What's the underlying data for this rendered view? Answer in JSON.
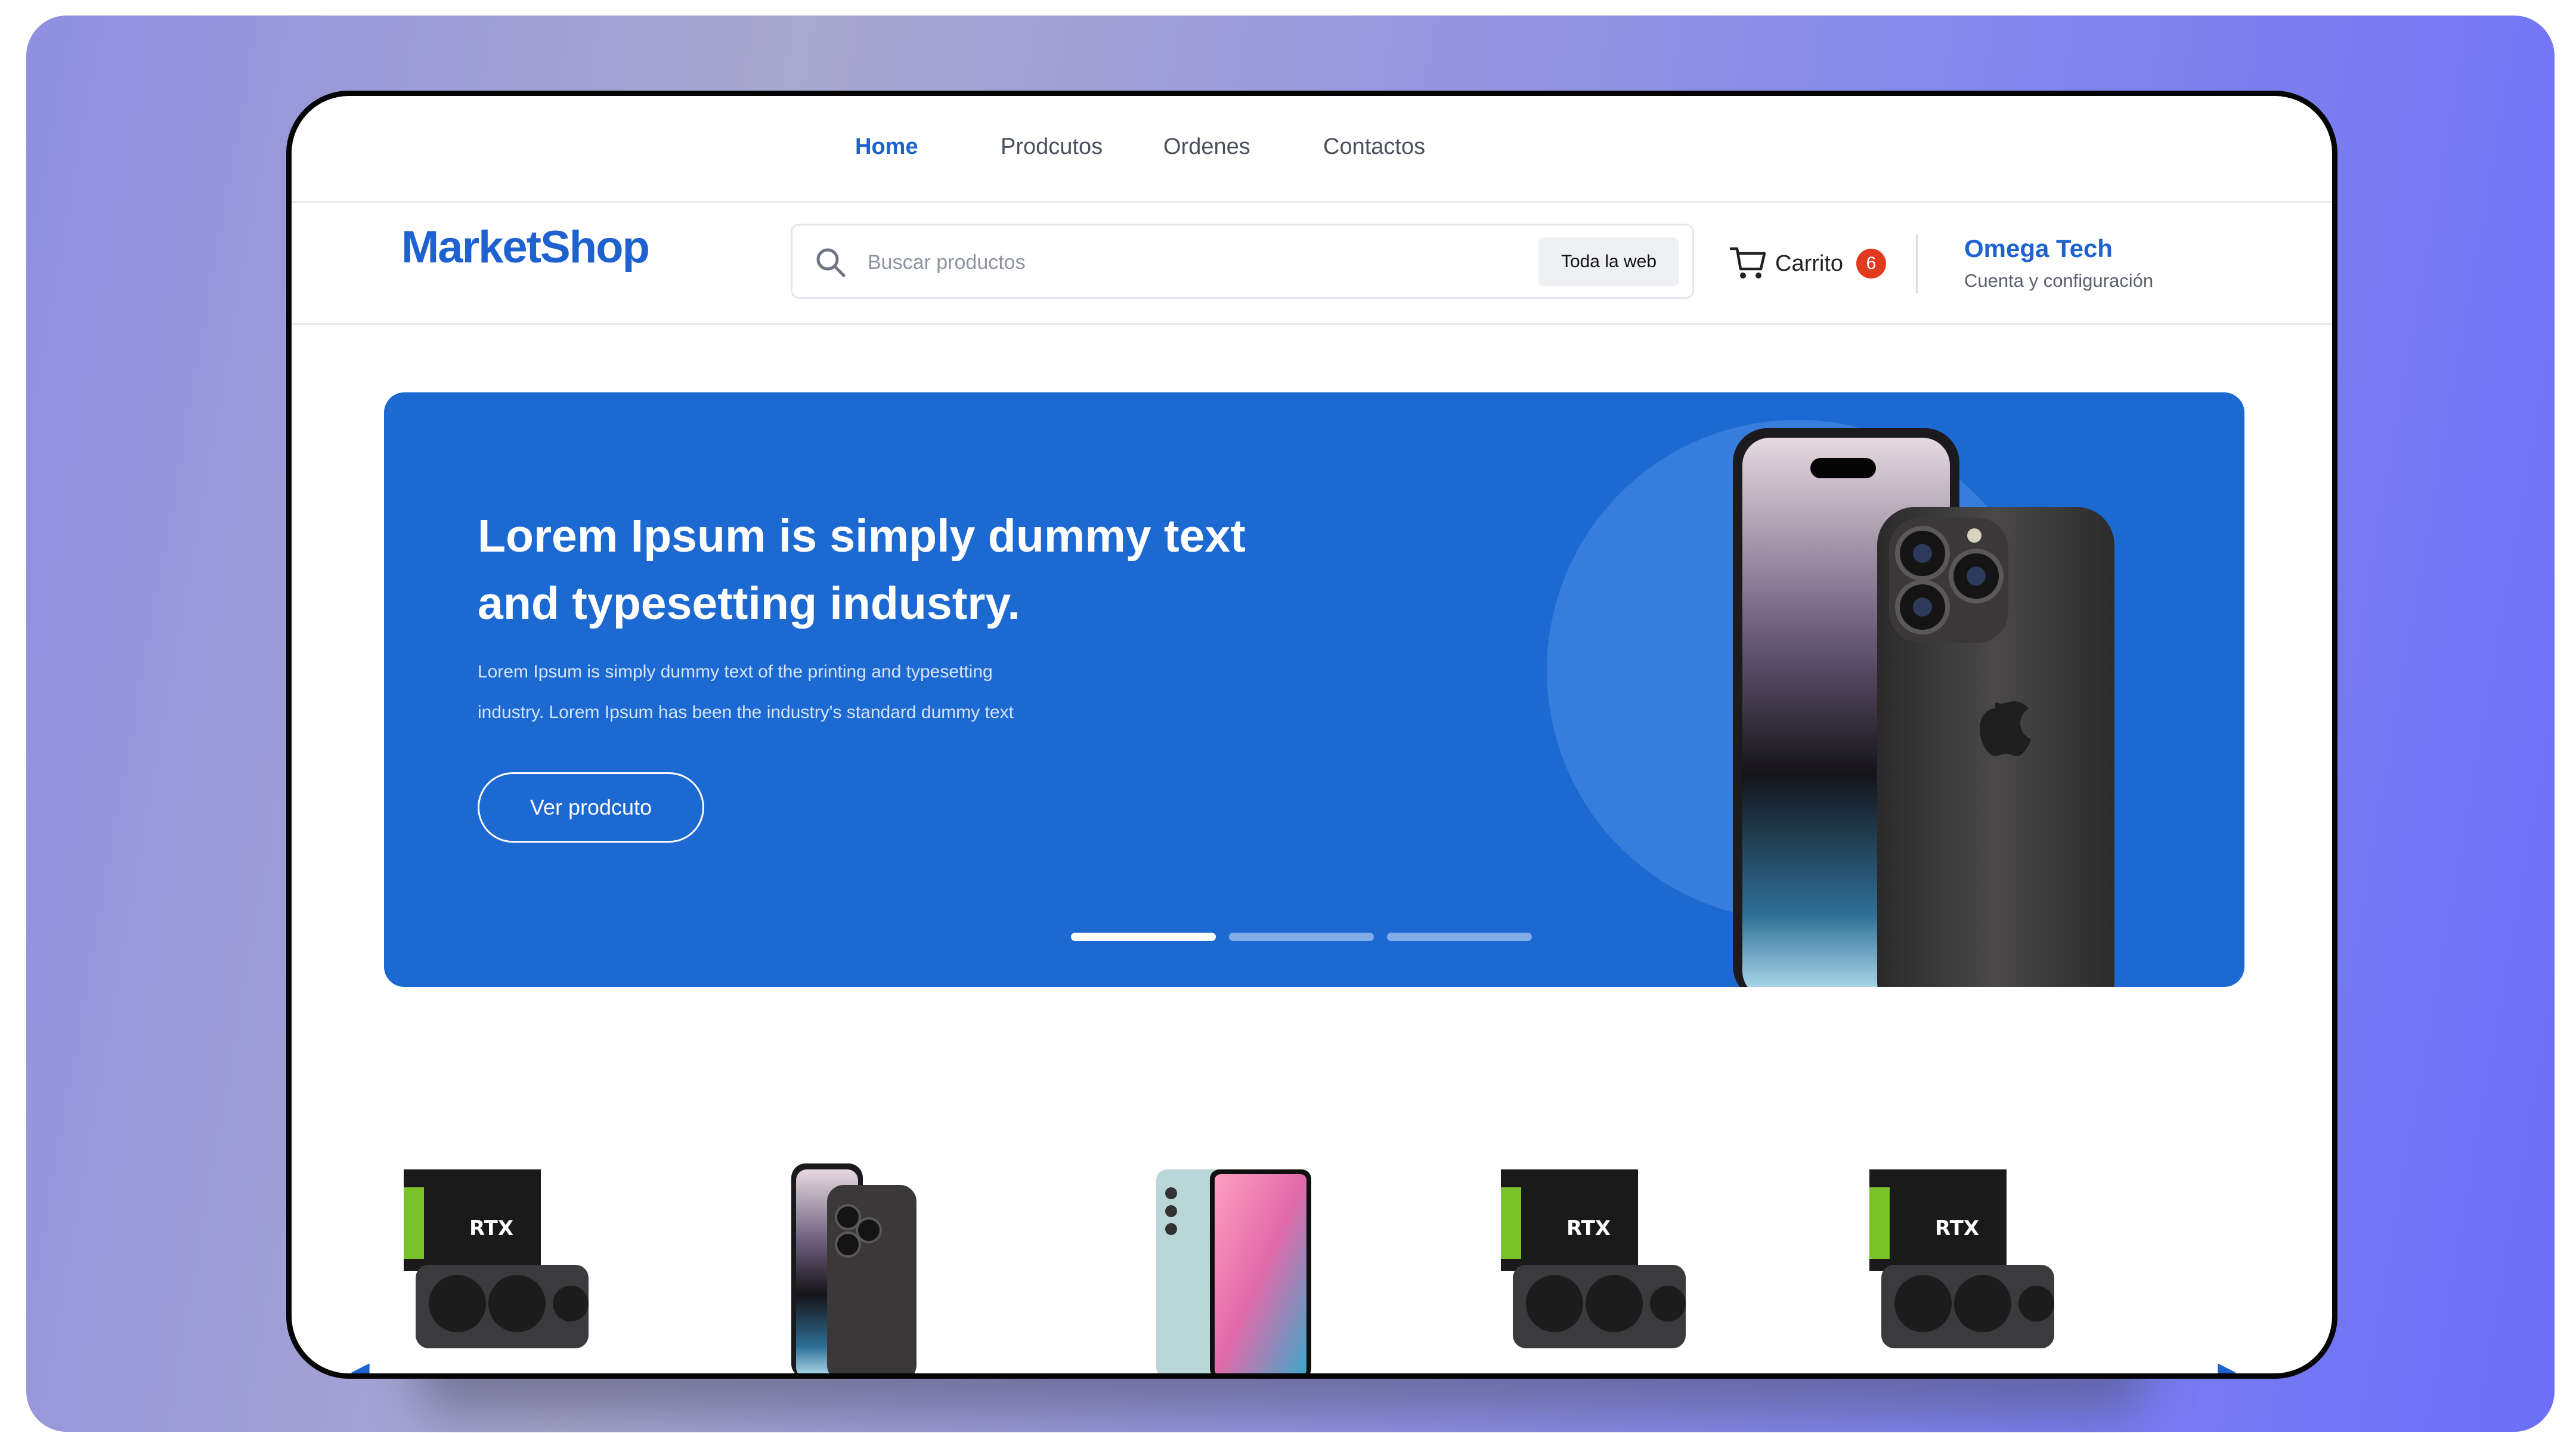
{
  "nav": {
    "items": [
      {
        "label": "Home",
        "active": true
      },
      {
        "label": "Prodcutos",
        "active": false
      },
      {
        "label": "Ordenes",
        "active": false
      },
      {
        "label": "Contactos",
        "active": false
      }
    ]
  },
  "header": {
    "logo": "MarketShop",
    "search": {
      "placeholder": "Buscar productos",
      "value": "",
      "scope_label": "Toda la web",
      "icon": "search-icon"
    },
    "cart": {
      "label": "Carrito",
      "count": "6",
      "icon": "cart-icon"
    },
    "account": {
      "name": "Omega Tech",
      "subtitle": "Cuenta y configuración"
    }
  },
  "hero": {
    "title_line1": "Lorem Ipsum is simply dummy text",
    "title_line2": "and typesetting industry.",
    "text_line1": "Lorem Ipsum is simply dummy text of the printing and typesetting",
    "text_line2": "industry. Lorem Ipsum has been the industry's standard dummy text",
    "button_label": "Ver prodcuto",
    "slides": 3,
    "active_slide": 1
  },
  "products": [
    {
      "kind": "graphics-card"
    },
    {
      "kind": "phone-dark"
    },
    {
      "kind": "phone-light"
    },
    {
      "kind": "graphics-card"
    },
    {
      "kind": "graphics-card"
    }
  ],
  "colors": {
    "brand": "#1d62cf",
    "hero_bg": "#1d69d2",
    "badge": "#e23a1e",
    "frame_bg_start": "#8f8fe2",
    "frame_bg_end": "#6b6ff8"
  }
}
